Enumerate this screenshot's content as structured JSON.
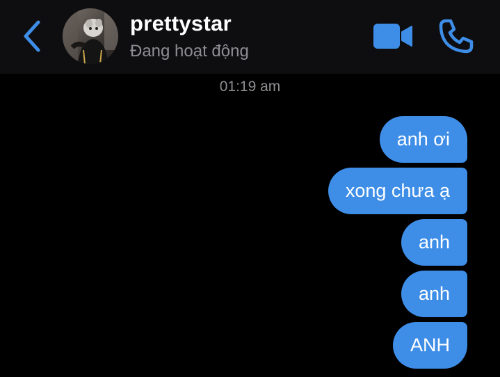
{
  "header": {
    "contact_name": "prettystar",
    "status": "Đang hoạt động",
    "back_icon": "chevron-left-icon",
    "video_icon": "video-camera-icon",
    "phone_icon": "phone-icon"
  },
  "conversation": {
    "timestamp": "01:19 am",
    "messages": [
      {
        "text": "anh ơi",
        "sender": "me"
      },
      {
        "text": "xong chưa ạ",
        "sender": "me"
      },
      {
        "text": "anh",
        "sender": "me"
      },
      {
        "text": "anh",
        "sender": "me"
      },
      {
        "text": "ANH",
        "sender": "me"
      }
    ]
  },
  "colors": {
    "accent": "#3e8ee8",
    "background": "#000000",
    "header_background": "#0e0e10",
    "secondary_text": "#8e8e93"
  }
}
